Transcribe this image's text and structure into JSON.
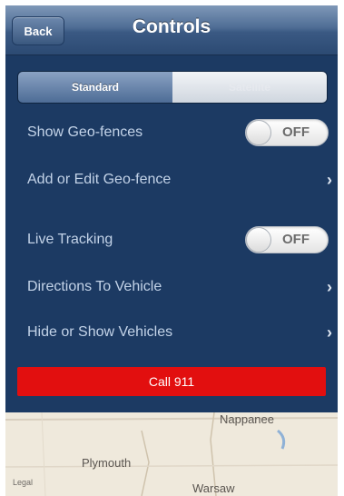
{
  "nav": {
    "back_label": "Back",
    "title": "Controls"
  },
  "segments": [
    {
      "label": "Standard",
      "selected": true
    },
    {
      "label": "Satellite",
      "selected": false
    }
  ],
  "rows": [
    {
      "label": "Show Geo-fences",
      "toggle": "OFF"
    },
    {
      "label": "Add or Edit Geo-fence"
    },
    {
      "label": "Live Tracking",
      "toggle": "OFF"
    },
    {
      "label": "Directions To Vehicle"
    },
    {
      "label": "Hide or Show Vehicles"
    }
  ],
  "call_button": {
    "label": "Call 911",
    "color": "#e20f0f"
  },
  "map": {
    "labels": [
      "Nappanee",
      "Plymouth",
      "Warsaw"
    ],
    "legal": "Legal"
  },
  "colors": {
    "panel": "#1c3a63",
    "row_text": "#c3d3e8"
  }
}
